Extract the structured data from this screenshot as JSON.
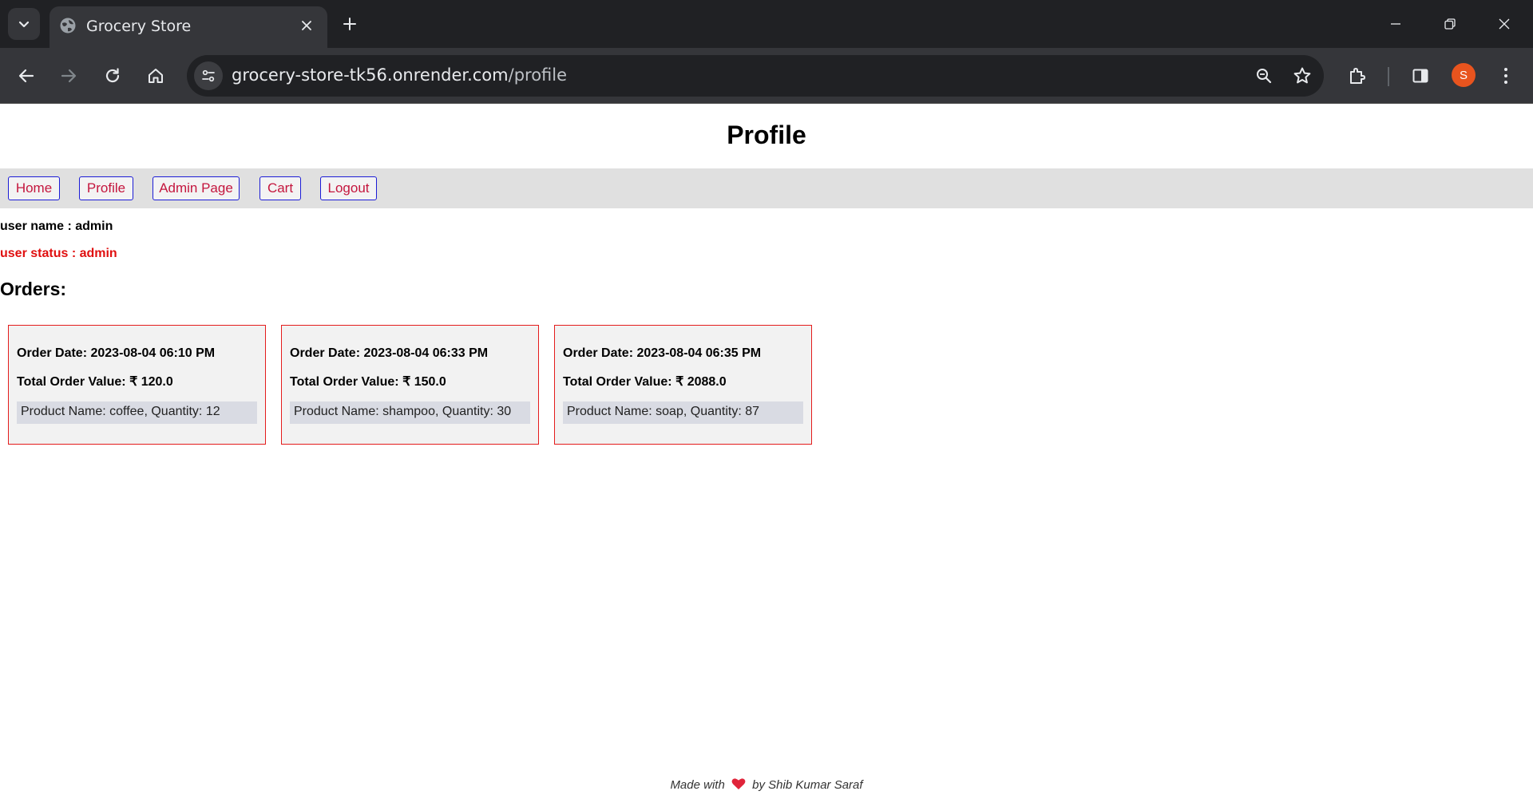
{
  "browser": {
    "tab_title": "Grocery Store",
    "url_host": "grocery-store-tk56.onrender.com",
    "url_path": "/profile",
    "profile_initial": "S",
    "icons": [
      "tab-search-icon",
      "globe-icon",
      "close-icon",
      "plus-icon",
      "minimize-icon",
      "restore-icon",
      "back-arrow-icon",
      "forward-arrow-icon",
      "reload-icon",
      "home-icon",
      "site-info-icon",
      "zoom-icon",
      "star-icon",
      "extensions-icon",
      "side-panel-icon",
      "kebab-menu-icon"
    ]
  },
  "page": {
    "title": "Profile",
    "nav": [
      {
        "label": "Home"
      },
      {
        "label": "Profile"
      },
      {
        "label": "Admin Page"
      },
      {
        "label": "Cart"
      },
      {
        "label": "Logout"
      }
    ],
    "user_name": "user name : admin",
    "user_status": "user status : admin",
    "orders_heading": "Orders:",
    "orders": [
      {
        "date": "Order Date: 2023-08-04 06:10 PM",
        "total": "Total Order Value: ₹ 120.0",
        "item": "Product Name: coffee, Quantity: 12"
      },
      {
        "date": "Order Date: 2023-08-04 06:33 PM",
        "total": "Total Order Value: ₹ 150.0",
        "item": "Product Name: shampoo, Quantity: 30"
      },
      {
        "date": "Order Date: 2023-08-04 06:35 PM",
        "total": "Total Order Value: ₹ 2088.0",
        "item": "Product Name: soap, Quantity: 87"
      }
    ],
    "footer": {
      "before": "Made with",
      "after": "by Shib Kumar Saraf"
    }
  },
  "colors": {
    "nav_border": "#1c1cd6",
    "nav_text": "#c4163e",
    "status_text": "#e01010",
    "card_border": "#e41c1c",
    "heart": "#e0243a"
  }
}
